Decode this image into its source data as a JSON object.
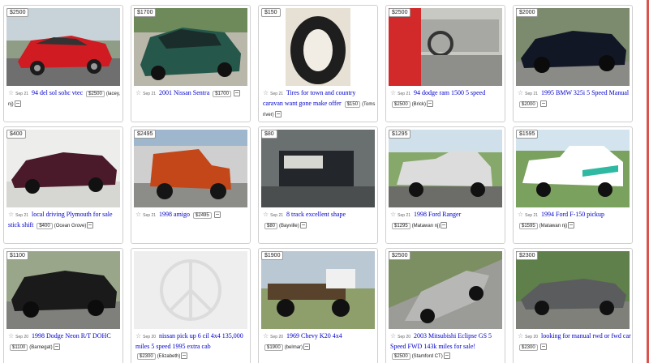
{
  "listings": [
    {
      "price_tag": "$2500",
      "date": "Sep 21",
      "title": "94 del sol sohc vtec",
      "price": "$2500",
      "hood": "(lacey, nj)"
    },
    {
      "price_tag": "$1700",
      "date": "Sep 21",
      "title": "2001 Nissan Sentra",
      "price": "$1700",
      "hood": ""
    },
    {
      "price_tag": "$150",
      "date": "Sep 21",
      "title": "Tires for town and country  caravan want gone make offer",
      "price": "$150",
      "hood": "(Toms river)"
    },
    {
      "price_tag": "$2500",
      "date": "Sep 21",
      "title": "94 dodge ram 1500 5 speed",
      "price": "$2500",
      "hood": "(Brick)"
    },
    {
      "price_tag": "$2000",
      "date": "Sep 21",
      "title": "1995 BMW 325i 5 Speed Manual",
      "price": "$2000",
      "hood": ""
    },
    {
      "price_tag": "$400",
      "date": "Sep 21",
      "title": "local driving Plymouth for sale stick shift",
      "price": "$400",
      "hood": "(Ocean Grove)"
    },
    {
      "price_tag": "$2495",
      "date": "Sep 21",
      "title": "1998 amigo",
      "price": "$2495",
      "hood": ""
    },
    {
      "price_tag": "$80",
      "date": "Sep 21",
      "title": "8 track excellent shape",
      "price": "$80",
      "hood": "(Bayville)"
    },
    {
      "price_tag": "$1295",
      "date": "Sep 21",
      "title": "1998 Ford Ranger",
      "price": "$1295",
      "hood": "(Matawan nj)"
    },
    {
      "price_tag": "$1595",
      "date": "Sep 21",
      "title": "1994 Ford F-150 pickup",
      "price": "$1595",
      "hood": "(Matawan nj)"
    },
    {
      "price_tag": "$1100",
      "date": "Sep 20",
      "title": "1998 Dodge Neon R/T DOHC",
      "price": "$1100",
      "hood": "(Barnegat)"
    },
    {
      "price_tag": "",
      "date": "Sep 20",
      "title": "nissan pick up 6 cil 4x4 135,000 miles 5 speed 1995 extra cab",
      "price": "$2300",
      "hood": "(Elizabeth)"
    },
    {
      "price_tag": "$1900",
      "date": "Sep 20",
      "title": "1969 Chevy K20 4x4",
      "price": "$1900",
      "hood": "(belmar)"
    },
    {
      "price_tag": "$2500",
      "date": "Sep 20",
      "title": "2003 Mitsubishi Eclipse GS 5 Speed FWD 143k miles for sale!",
      "price": "$2500",
      "hood": "(Stamford CT)"
    },
    {
      "price_tag": "$2300",
      "date": "Sep 20",
      "title": "looking for manual rwd or fwd car",
      "price": "$2300",
      "hood": ""
    }
  ],
  "icons": {
    "favorite": "star-icon",
    "hide": "hide-icon"
  },
  "colors": {
    "link": "#0000cc",
    "accent_edge": "#d9534f"
  }
}
